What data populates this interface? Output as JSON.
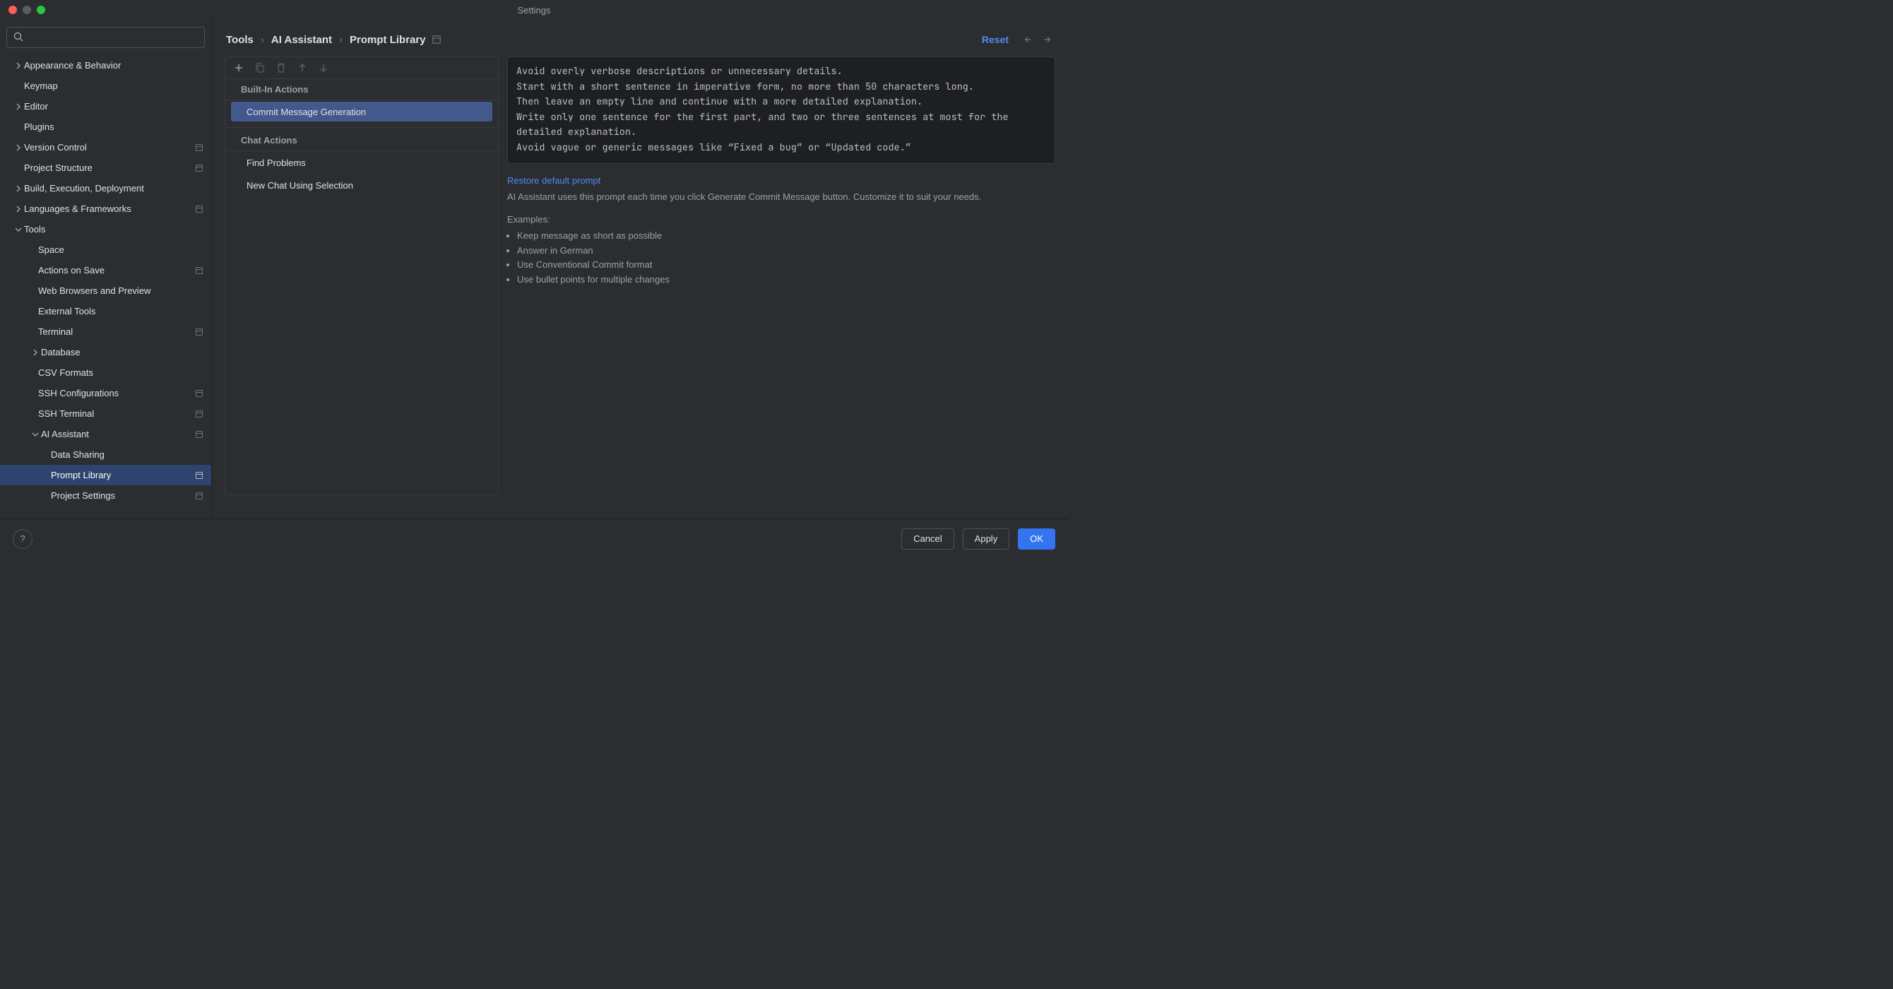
{
  "window": {
    "title": "Settings"
  },
  "sidebar": {
    "items": [
      {
        "label": "Appearance & Behavior"
      },
      {
        "label": "Keymap"
      },
      {
        "label": "Editor"
      },
      {
        "label": "Plugins"
      },
      {
        "label": "Version Control"
      },
      {
        "label": "Project Structure"
      },
      {
        "label": "Build, Execution, Deployment"
      },
      {
        "label": "Languages & Frameworks"
      },
      {
        "label": "Tools"
      },
      {
        "label": "Space"
      },
      {
        "label": "Actions on Save"
      },
      {
        "label": "Web Browsers and Preview"
      },
      {
        "label": "External Tools"
      },
      {
        "label": "Terminal"
      },
      {
        "label": "Database"
      },
      {
        "label": "CSV Formats"
      },
      {
        "label": "SSH Configurations"
      },
      {
        "label": "SSH Terminal"
      },
      {
        "label": "AI Assistant"
      },
      {
        "label": "Data Sharing"
      },
      {
        "label": "Prompt Library"
      },
      {
        "label": "Project Settings"
      }
    ]
  },
  "breadcrumb": {
    "a": "Tools",
    "b": "AI Assistant",
    "c": "Prompt Library",
    "sep": "›"
  },
  "header": {
    "reset": "Reset"
  },
  "actions": {
    "builtin_header": "Built-In Actions",
    "builtin_items": [
      {
        "label": "Commit Message Generation"
      }
    ],
    "chat_header": "Chat Actions",
    "chat_items": [
      {
        "label": "Find Problems"
      },
      {
        "label": "New Chat Using Selection"
      }
    ]
  },
  "prompt": {
    "text": "Avoid overly verbose descriptions or unnecessary details.\nStart with a short sentence in imperative form, no more than 50 characters long.\nThen leave an empty line and continue with a more detailed explanation.\nWrite only one sentence for the first part, and two or three sentences at most for the detailed explanation.\nAvoid vague or generic messages like “Fixed a bug” or “Updated code.”",
    "restore": "Restore default prompt",
    "desc": "AI Assistant uses this prompt each time you click Generate Commit Message button. Customize it to suit your needs.",
    "examples_head": "Examples:",
    "examples": [
      "Keep message as short as possible",
      "Answer in German",
      "Use Conventional Commit format",
      "Use bullet points for multiple changes"
    ]
  },
  "footer": {
    "cancel": "Cancel",
    "apply": "Apply",
    "ok": "OK",
    "help": "?"
  }
}
